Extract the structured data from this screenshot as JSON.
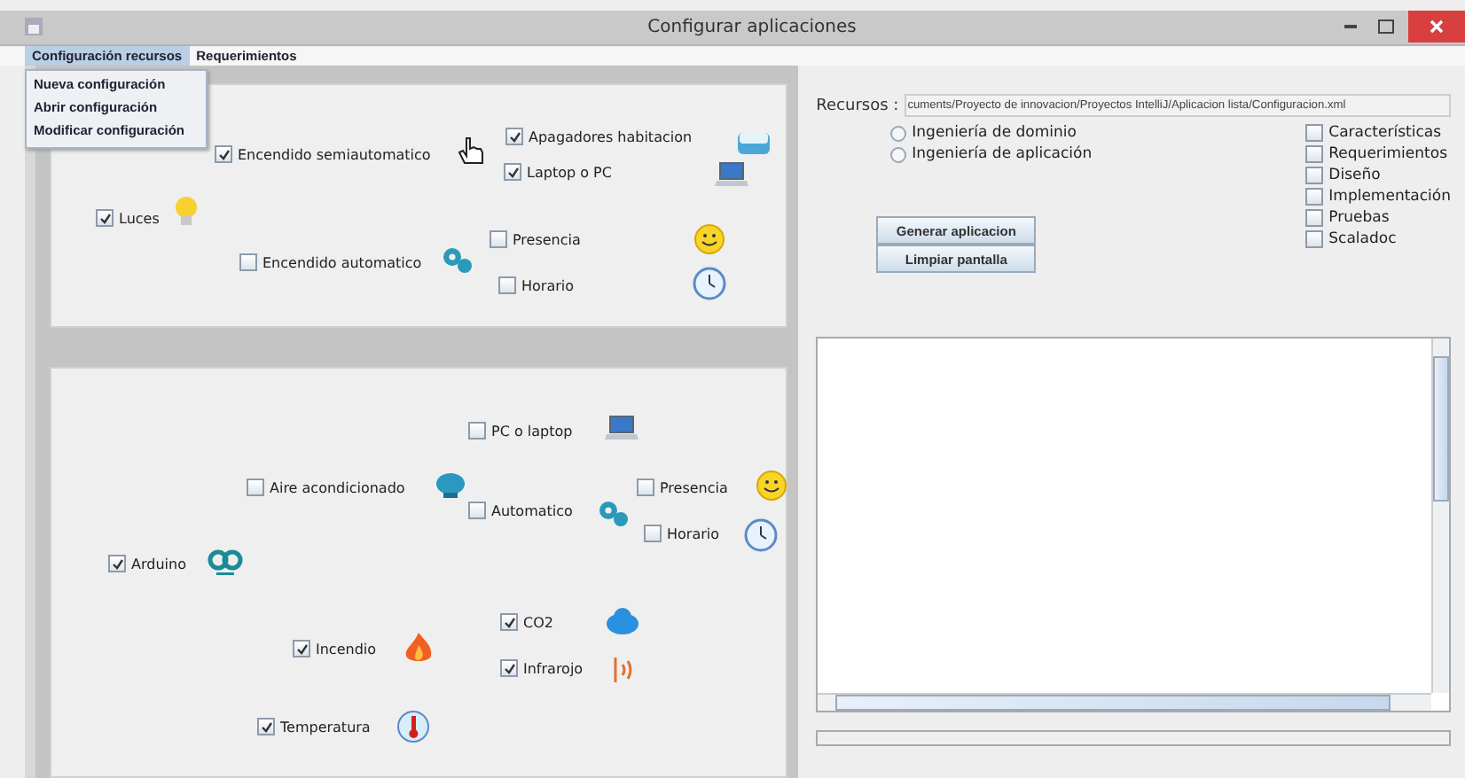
{
  "window": {
    "title": "Configurar aplicaciones"
  },
  "menu_bar": [
    {
      "label": "Configuración recursos",
      "selected": true
    },
    {
      "label": "Requerimientos",
      "selected": false
    }
  ],
  "open_menu": [
    "Nueva configuración",
    "Abrir configuración",
    "Modificar configuración"
  ],
  "panel_top": [
    {
      "label": "Apagadores habitacion",
      "checked": true
    },
    {
      "label": "Encendido semiautomatico",
      "checked": true
    },
    {
      "label": "Laptop o PC",
      "checked": true
    },
    {
      "label": "Luces",
      "checked": true
    },
    {
      "label": "Presencia",
      "checked": false
    },
    {
      "label": "Encendido automatico",
      "checked": false
    },
    {
      "label": "Horario",
      "checked": false
    }
  ],
  "panel_bottom": [
    {
      "label": "PC o laptop",
      "checked": false
    },
    {
      "label": "Aire acondicionado",
      "checked": false
    },
    {
      "label": "Presencia",
      "checked": false
    },
    {
      "label": "Automatico",
      "checked": false
    },
    {
      "label": "Horario",
      "checked": false
    },
    {
      "label": "Arduino",
      "checked": true
    },
    {
      "label": "CO2",
      "checked": true
    },
    {
      "label": "Incendio",
      "checked": true
    },
    {
      "label": "Infrarojo",
      "checked": true
    },
    {
      "label": "Temperatura",
      "checked": true
    }
  ],
  "resources": {
    "label": "Recursos :",
    "path": "cuments/Proyecto de innovacion/Proyectos IntelliJ/Aplicacion lista/Configuracion.xml"
  },
  "modes": [
    {
      "label": "Ingeniería de dominio",
      "selected": false
    },
    {
      "label": "Ingeniería de aplicación",
      "selected": false
    }
  ],
  "buttons": [
    "Generar aplicacion",
    "Limpiar pantalla"
  ],
  "phases": [
    {
      "label": "Características",
      "checked": false
    },
    {
      "label": "Requerimientos",
      "checked": false
    },
    {
      "label": "Diseño",
      "checked": false
    },
    {
      "label": "Implementación",
      "checked": false
    },
    {
      "label": "Pruebas",
      "checked": false
    },
    {
      "label": "Scaladoc",
      "checked": false
    }
  ]
}
